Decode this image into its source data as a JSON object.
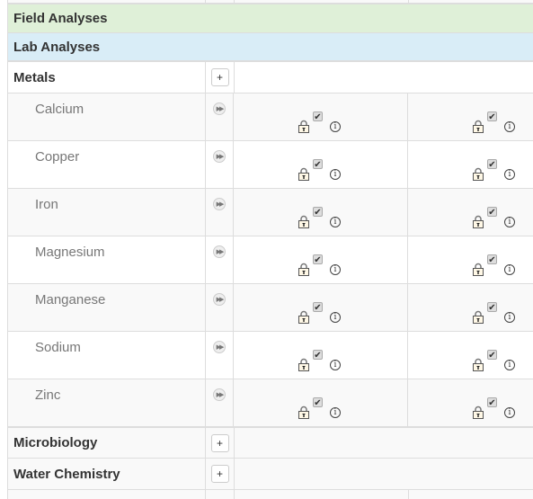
{
  "groups": {
    "field": "Field Analyses",
    "lab": "Lab Analyses"
  },
  "categories": {
    "metals": {
      "label": "Metals",
      "expand_label": "+"
    },
    "microbiology": {
      "label": "Microbiology",
      "expand_label": "+"
    },
    "water_chemistry": {
      "label": "Water Chemistry",
      "expand_label": "+"
    }
  },
  "analytes": [
    {
      "name": "Calcium",
      "columns": [
        {
          "locked": true,
          "checked": true
        },
        {
          "locked": true,
          "checked": true
        }
      ]
    },
    {
      "name": "Copper",
      "columns": [
        {
          "locked": true,
          "checked": true
        },
        {
          "locked": true,
          "checked": true
        }
      ]
    },
    {
      "name": "Iron",
      "columns": [
        {
          "locked": true,
          "checked": true
        },
        {
          "locked": true,
          "checked": true
        }
      ]
    },
    {
      "name": "Magnesium",
      "columns": [
        {
          "locked": true,
          "checked": true
        },
        {
          "locked": true,
          "checked": true
        }
      ]
    },
    {
      "name": "Manganese",
      "columns": [
        {
          "locked": true,
          "checked": true
        },
        {
          "locked": true,
          "checked": true
        }
      ]
    },
    {
      "name": "Sodium",
      "columns": [
        {
          "locked": true,
          "checked": true
        },
        {
          "locked": true,
          "checked": true
        }
      ]
    },
    {
      "name": "Zinc",
      "columns": [
        {
          "locked": true,
          "checked": true
        },
        {
          "locked": true,
          "checked": true
        }
      ]
    }
  ],
  "icons": {
    "lock": "lock-icon",
    "checkbox": "checkbox-icon",
    "info": "info-icon",
    "select_row": "fast-forward-icon",
    "check_glyph": "✔",
    "info_glyph": "i",
    "play_glyph": "▶▶"
  },
  "colors": {
    "field_group_bg": "#dff0d8",
    "lab_group_bg": "#d9edf7",
    "stripe_bg": "#f9f9f9",
    "border": "#dddddd"
  }
}
